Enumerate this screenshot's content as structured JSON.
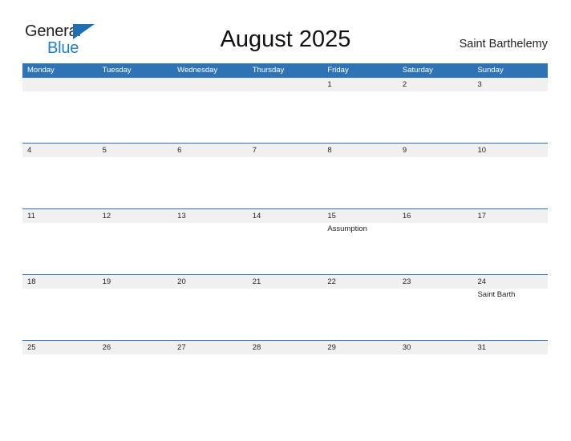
{
  "brand": {
    "name_part1": "General",
    "name_part2": "Blue",
    "flag_icon": "blue-triangle-flag-icon",
    "color_dark": "#231f20",
    "color_blue": "#1f7fc4"
  },
  "header": {
    "title": "August 2025",
    "location": "Saint Barthelemy"
  },
  "colors": {
    "header_blue": "#2e74b5",
    "day_band_gray": "#f0f0f0",
    "text": "#231f20",
    "background": "#ffffff"
  },
  "calendar": {
    "month": "August",
    "year": "2025",
    "weekdays": [
      "Monday",
      "Tuesday",
      "Wednesday",
      "Thursday",
      "Friday",
      "Saturday",
      "Sunday"
    ],
    "weeks": [
      {
        "days": [
          {
            "number": "",
            "event": ""
          },
          {
            "number": "",
            "event": ""
          },
          {
            "number": "",
            "event": ""
          },
          {
            "number": "",
            "event": ""
          },
          {
            "number": "1",
            "event": ""
          },
          {
            "number": "2",
            "event": ""
          },
          {
            "number": "3",
            "event": ""
          }
        ]
      },
      {
        "days": [
          {
            "number": "4",
            "event": ""
          },
          {
            "number": "5",
            "event": ""
          },
          {
            "number": "6",
            "event": ""
          },
          {
            "number": "7",
            "event": ""
          },
          {
            "number": "8",
            "event": ""
          },
          {
            "number": "9",
            "event": ""
          },
          {
            "number": "10",
            "event": ""
          }
        ]
      },
      {
        "days": [
          {
            "number": "11",
            "event": ""
          },
          {
            "number": "12",
            "event": ""
          },
          {
            "number": "13",
            "event": ""
          },
          {
            "number": "14",
            "event": ""
          },
          {
            "number": "15",
            "event": "Assumption"
          },
          {
            "number": "16",
            "event": ""
          },
          {
            "number": "17",
            "event": ""
          }
        ]
      },
      {
        "days": [
          {
            "number": "18",
            "event": ""
          },
          {
            "number": "19",
            "event": ""
          },
          {
            "number": "20",
            "event": ""
          },
          {
            "number": "21",
            "event": ""
          },
          {
            "number": "22",
            "event": ""
          },
          {
            "number": "23",
            "event": ""
          },
          {
            "number": "24",
            "event": "Saint Barth"
          }
        ]
      },
      {
        "days": [
          {
            "number": "25",
            "event": ""
          },
          {
            "number": "26",
            "event": ""
          },
          {
            "number": "27",
            "event": ""
          },
          {
            "number": "28",
            "event": ""
          },
          {
            "number": "29",
            "event": ""
          },
          {
            "number": "30",
            "event": ""
          },
          {
            "number": "31",
            "event": ""
          }
        ]
      }
    ]
  }
}
